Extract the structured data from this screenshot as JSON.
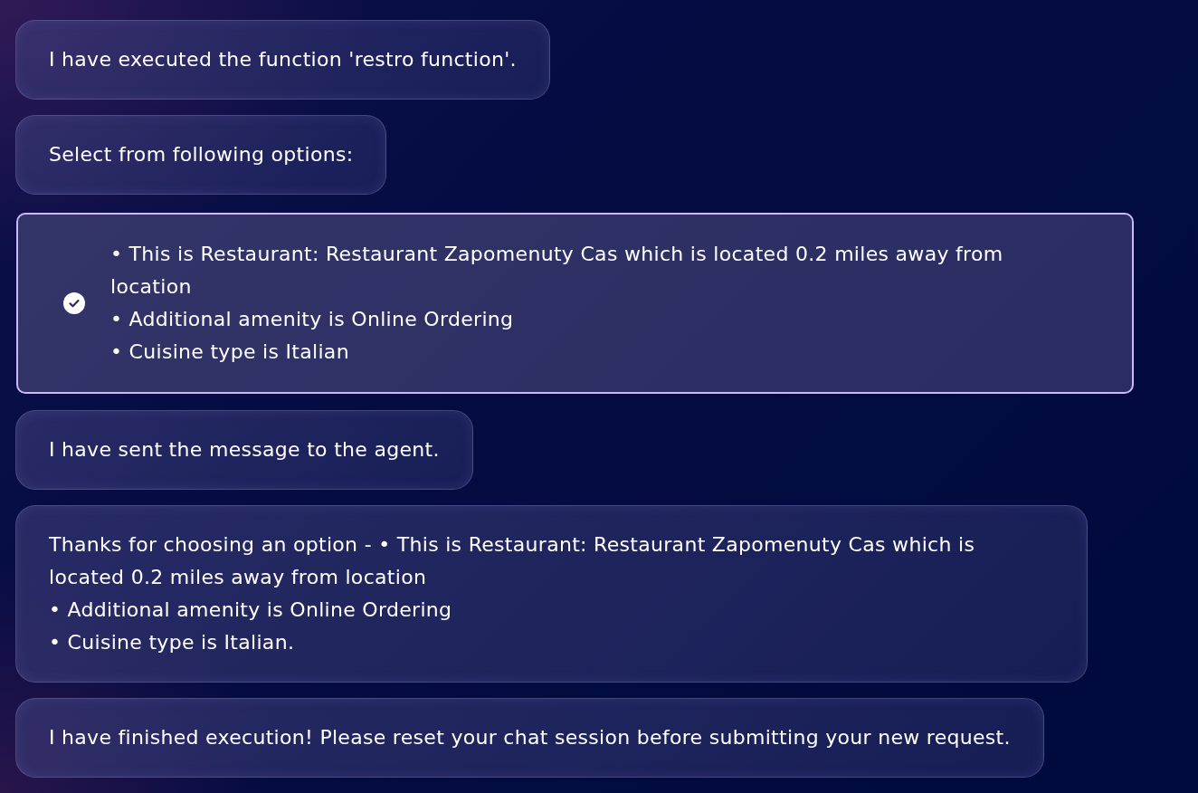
{
  "messages": [
    {
      "kind": "bubble",
      "text": "I have executed the function 'restro function'."
    },
    {
      "kind": "bubble",
      "text": "Select from following options:"
    },
    {
      "kind": "options",
      "options": [
        {
          "text": "• This is Restaurant: Restaurant Zapomenuty Cas which is located 0.2 miles away from location\n• Additional amenity is Online Ordering\n• Cuisine type is Italian",
          "selected": true
        }
      ]
    },
    {
      "kind": "bubble",
      "text": "I have sent the message to the agent."
    },
    {
      "kind": "bubble",
      "text": "Thanks for choosing an option - • This is Restaurant: Restaurant Zapomenuty Cas which is located 0.2 miles away from location\n• Additional amenity is Online Ordering\n• Cuisine type is Italian."
    },
    {
      "kind": "bubble",
      "text": "I have finished execution! Please reset your chat session before submitting your new request."
    }
  ]
}
